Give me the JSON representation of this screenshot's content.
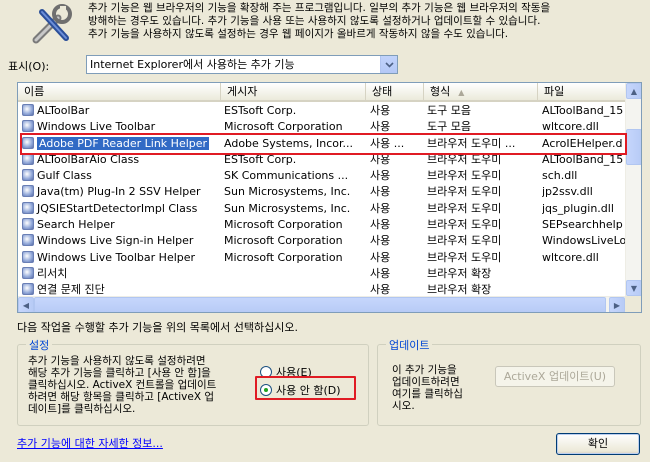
{
  "header": {
    "lines": [
      "추가 기능은 웹 브라우저의 기능을 확장해 주는 프로그램입니다. 일부의 추가 기능은 웹 브라우저의 작동을",
      "방해하는 경우도 있습니다. 추가 기능을 사용 또는 사용하지 않도록 설정하거나 업데이트할 수 있습니다.",
      "추가 기능을 사용하지 않도록 설정하는 경우 웹 페이지가 올바르게 작동하지 않을 수도 있습니다."
    ]
  },
  "show_filter": {
    "label": "표시(O):",
    "value": "Internet Explorer에서 사용하는 추가 기능"
  },
  "list": {
    "columns": [
      "이름",
      "게시자",
      "상태",
      "형식",
      "파일"
    ],
    "rows": [
      {
        "name": "ALToolBar",
        "publisher": "ESTsoft Corp.",
        "status": "사용",
        "type": "도구 모음",
        "file": "ALToolBand_15"
      },
      {
        "name": "Windows Live Toolbar",
        "publisher": "Microsoft Corporation",
        "status": "사용",
        "type": "도구 모음",
        "file": "wltcore.dll"
      },
      {
        "name": "Adobe PDF Reader Link Helper",
        "publisher": "Adobe Systems, Incor...",
        "status": "사용 ...",
        "type": "브라우저 도우미 ...",
        "file": "AcroIEHelper.d",
        "selected": true
      },
      {
        "name": "ALToolBarAio Class",
        "publisher": "ESTsoft Corp.",
        "status": "사용",
        "type": "브라우저 도우미",
        "file": "ALToolBand_15"
      },
      {
        "name": "Gulf Class",
        "publisher": "SK Communications ...",
        "status": "사용",
        "type": "브라우저 도우미",
        "file": "sch.dll"
      },
      {
        "name": "Java(tm) Plug-In 2 SSV Helper",
        "publisher": "Sun Microsystems, Inc.",
        "status": "사용",
        "type": "브라우저 도우미",
        "file": "jp2ssv.dll"
      },
      {
        "name": "JQSIEStartDetectorImpl Class",
        "publisher": "Sun Microsystems, Inc.",
        "status": "사용",
        "type": "브라우저 도우미",
        "file": "jqs_plugin.dll"
      },
      {
        "name": "Search Helper",
        "publisher": "Microsoft Corporation",
        "status": "사용",
        "type": "브라우저 도우미",
        "file": "SEPsearchhelp"
      },
      {
        "name": "Windows Live Sign-in Helper",
        "publisher": "Microsoft Corporation",
        "status": "사용",
        "type": "브라우저 도우미",
        "file": "WindowsLiveLo"
      },
      {
        "name": "Windows Live Toolbar Helper",
        "publisher": "Microsoft Corporation",
        "status": "사용",
        "type": "브라우저 도우미",
        "file": "wltcore.dll"
      },
      {
        "name": "리서치",
        "publisher": "",
        "status": "사용",
        "type": "브라우저 확장",
        "file": ""
      },
      {
        "name": "연결 문제 진단",
        "publisher": "",
        "status": "사용",
        "type": "브라우저 확장",
        "file": ""
      }
    ]
  },
  "instruction": "다음 작업을 수행할 추가 기능을 위의 목록에서 선택하십시오.",
  "settings": {
    "title": "설정",
    "description_lines": [
      "추가 기능을 사용하지 않도록 설정하려면",
      "해당 추가 기능을 클릭하고 [사용 안 함]을",
      "클릭하십시오. ActiveX 컨트롤을 업데이트",
      "하려면 해당 항목을 클릭하고 [ActiveX 업",
      "데이트]를 클릭하십시오."
    ],
    "enable_label": "사용(E)",
    "disable_label": "사용 안 함(D)"
  },
  "update": {
    "title": "업데이트",
    "description_lines": [
      "이 추가 기능을",
      "업데이트하려면",
      "여기를 클릭하십",
      "시오."
    ],
    "activex_button": "ActiveX 업데이트(U)"
  },
  "footer": {
    "more_info_link": "추가 기능에 대한 자세한 정보...",
    "ok_button": "확인"
  },
  "colors": {
    "selection": "#316ac5",
    "highlight_annotation": "#e01b24",
    "group_title": "#0046d5",
    "link": "#0000ff"
  }
}
